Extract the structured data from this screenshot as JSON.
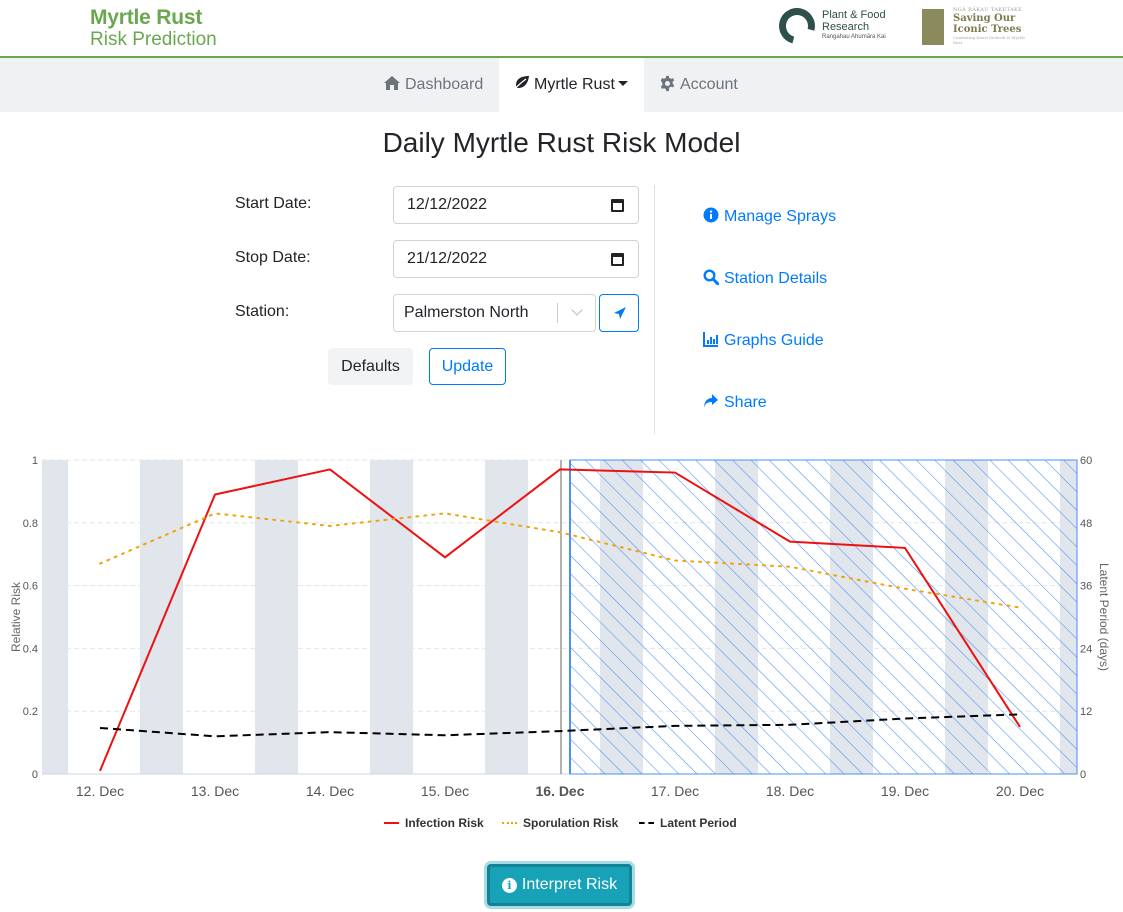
{
  "brand": {
    "line1": "Myrtle Rust",
    "line2": "Risk Prediction"
  },
  "partner_logos": {
    "pfr": {
      "name_line1": "Plant & Food",
      "name_line2": "Research",
      "tagline": "Rangahau Ahumāra Kai"
    },
    "soit": {
      "kicker": "NGĀ RĀKAU TAKETAKE",
      "line1": "Saving Our",
      "line2": "Iconic Trees",
      "tagline": "Combating Kauri Dieback & Myrtle Rust"
    }
  },
  "nav": {
    "items": [
      {
        "label": "Dashboard",
        "icon": "home-icon"
      },
      {
        "label": "Myrtle Rust",
        "icon": "leaf-icon",
        "active": true
      },
      {
        "label": "Account",
        "icon": "gear-icon"
      }
    ]
  },
  "page_title": "Daily Myrtle Rust Risk Model",
  "form": {
    "start_label": "Start Date:",
    "start_value": "12/12/2022",
    "stop_label": "Stop Date:",
    "stop_value": "21/12/2022",
    "station_label": "Station:",
    "station_value": "Palmerston North",
    "defaults_label": "Defaults",
    "update_label": "Update"
  },
  "links": [
    {
      "label": "Manage Sprays",
      "icon": "info-circle-icon"
    },
    {
      "label": "Station Details",
      "icon": "search-icon"
    },
    {
      "label": "Graphs Guide",
      "icon": "chart-icon"
    },
    {
      "label": "Share",
      "icon": "share-icon"
    }
  ],
  "chart_data": {
    "type": "line",
    "categories": [
      "12. Dec",
      "13. Dec",
      "14. Dec",
      "15. Dec",
      "16. Dec",
      "17. Dec",
      "18. Dec",
      "19. Dec",
      "20. Dec"
    ],
    "highlighted_category": "16. Dec",
    "ylabel": "Relative Risk",
    "ylabel_right": "Latent Period (days)",
    "y_ticks": [
      "0",
      "0.2",
      "0.4",
      "0.6",
      "0.8",
      "1"
    ],
    "y_right_ticks": [
      "0",
      "12",
      "24",
      "36",
      "48",
      "60"
    ],
    "ylim": [
      0,
      1
    ],
    "ylim_right": [
      0,
      60
    ],
    "forecast_shaded_from": "16. Dec",
    "series": [
      {
        "name": "Infection Risk",
        "axis": "left",
        "color": "#ee1111",
        "style": "solid",
        "values": [
          0.01,
          0.89,
          0.97,
          0.69,
          0.97,
          0.96,
          0.74,
          0.72,
          0.15
        ]
      },
      {
        "name": "Sporulation Risk",
        "axis": "left",
        "color": "#f0a30a",
        "style": "dotted",
        "values": [
          0.67,
          0.83,
          0.79,
          0.83,
          0.77,
          0.68,
          0.66,
          0.59,
          0.53
        ]
      },
      {
        "name": "Latent Period",
        "axis": "right",
        "color": "#000000",
        "style": "dashed",
        "values": [
          8.8,
          7.2,
          8.0,
          7.4,
          8.2,
          9.2,
          9.4,
          10.6,
          11.4
        ]
      }
    ],
    "legend_position": "bottom-center",
    "grid": true
  },
  "interpret_label": "Interpret Risk"
}
